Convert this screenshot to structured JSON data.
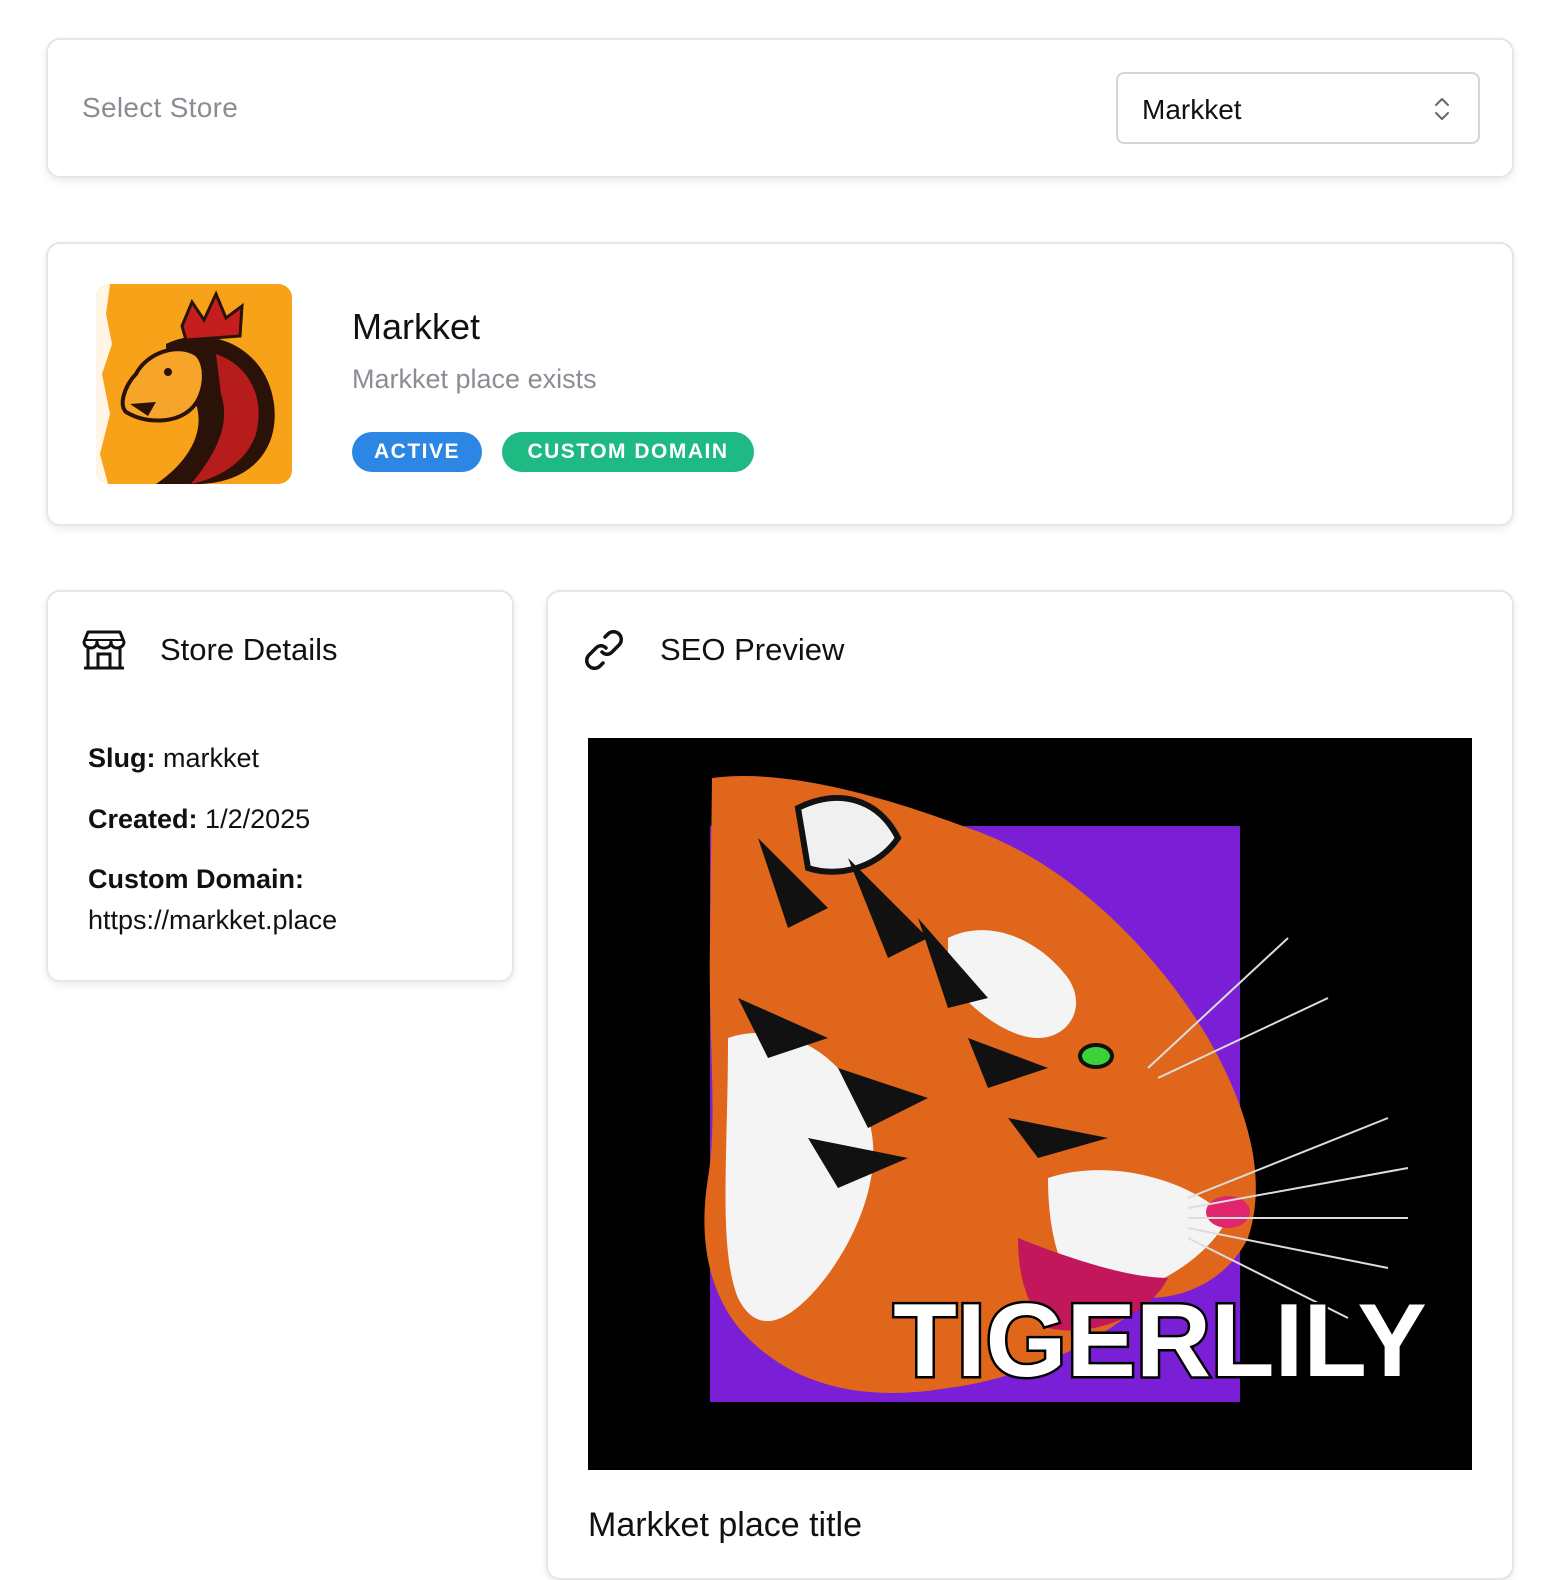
{
  "store_selector": {
    "label": "Select Store",
    "selected": "Markket",
    "chevron_icon": "chevron-up-down-icon"
  },
  "store": {
    "name": "Markket",
    "description": "Markket place exists",
    "logo_icon": "lion-crown-logo",
    "badges": {
      "active": "ACTIVE",
      "custom_domain": "CUSTOM DOMAIN"
    }
  },
  "details": {
    "icon": "storefront-icon",
    "title": "Store Details",
    "slug_label": "Slug:",
    "slug_value": "markket",
    "created_label": "Created:",
    "created_value": "1/2/2025",
    "domain_label": "Custom Domain:",
    "domain_value": "https://markket.place"
  },
  "seo": {
    "icon": "link-icon",
    "title": "SEO Preview",
    "image_text": "TIGERLILY",
    "og_title": "Markket place title"
  },
  "colors": {
    "badge_active": "#2b87e3",
    "badge_domain": "#1fb984",
    "muted_text": "#8a8d93",
    "logo_orange": "#f8a21a",
    "seo_purple": "#7a1fd6"
  }
}
